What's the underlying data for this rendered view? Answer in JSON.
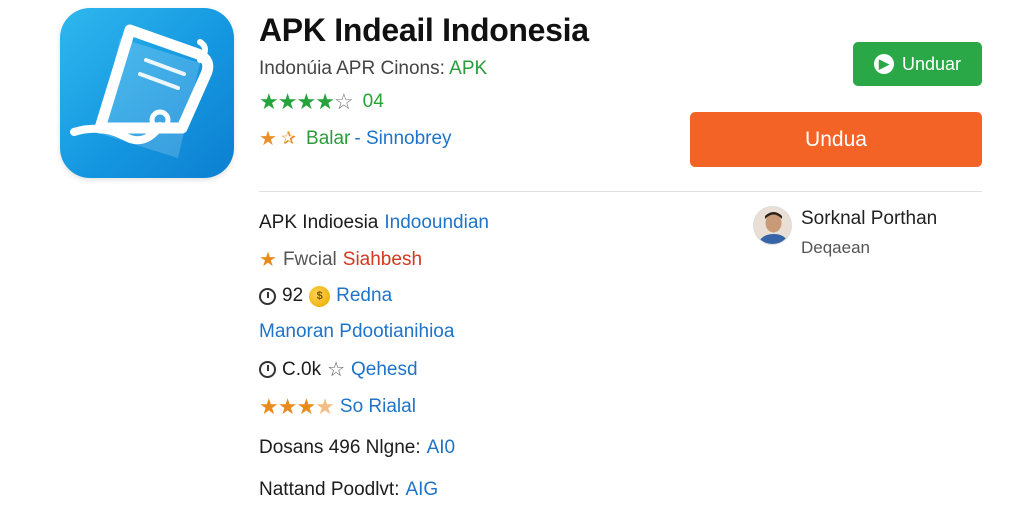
{
  "app": {
    "icon": "document-pen-icon",
    "title": "APK Indeail Indonesia",
    "subtitle_prefix": "Indonúia APR Cinons: ",
    "subtitle_accent": "APK",
    "rating": {
      "stars_filled": 4,
      "stars_total": 5,
      "value": "04"
    },
    "developer_label": "Balar",
    "developer_name": "Sinnobrey"
  },
  "buttons": {
    "small_download": {
      "icon": "play-store-icon",
      "label": "Unduar"
    },
    "big_download": {
      "label": "Undua"
    }
  },
  "info": {
    "line1": {
      "text": "APK Indioesia ",
      "link": "Indooundian"
    },
    "line2": {
      "text": "Fwcial ",
      "accent": "Siahbesh"
    },
    "line3": {
      "value": "92",
      "link": "Redna"
    },
    "line4": {
      "link": "Manoran Pdootianihioa"
    },
    "line5": {
      "value": "C.0k",
      "link": "Qehesd"
    },
    "line6": {
      "stars_filled": 3.5,
      "link": "So Rialal"
    },
    "line7": {
      "text": "Dosans 496 Nlgne: ",
      "link": "AI0"
    },
    "line8": {
      "text": "Nattand Poodlvt: ",
      "link": "AIG"
    }
  },
  "author": {
    "name": "Sorknal Porthan",
    "role": "Deqaean"
  },
  "colors": {
    "brand_green": "#2aa746",
    "download_orange": "#f26325",
    "link_blue": "#1e74c8",
    "star_orange": "#e98a1e"
  }
}
